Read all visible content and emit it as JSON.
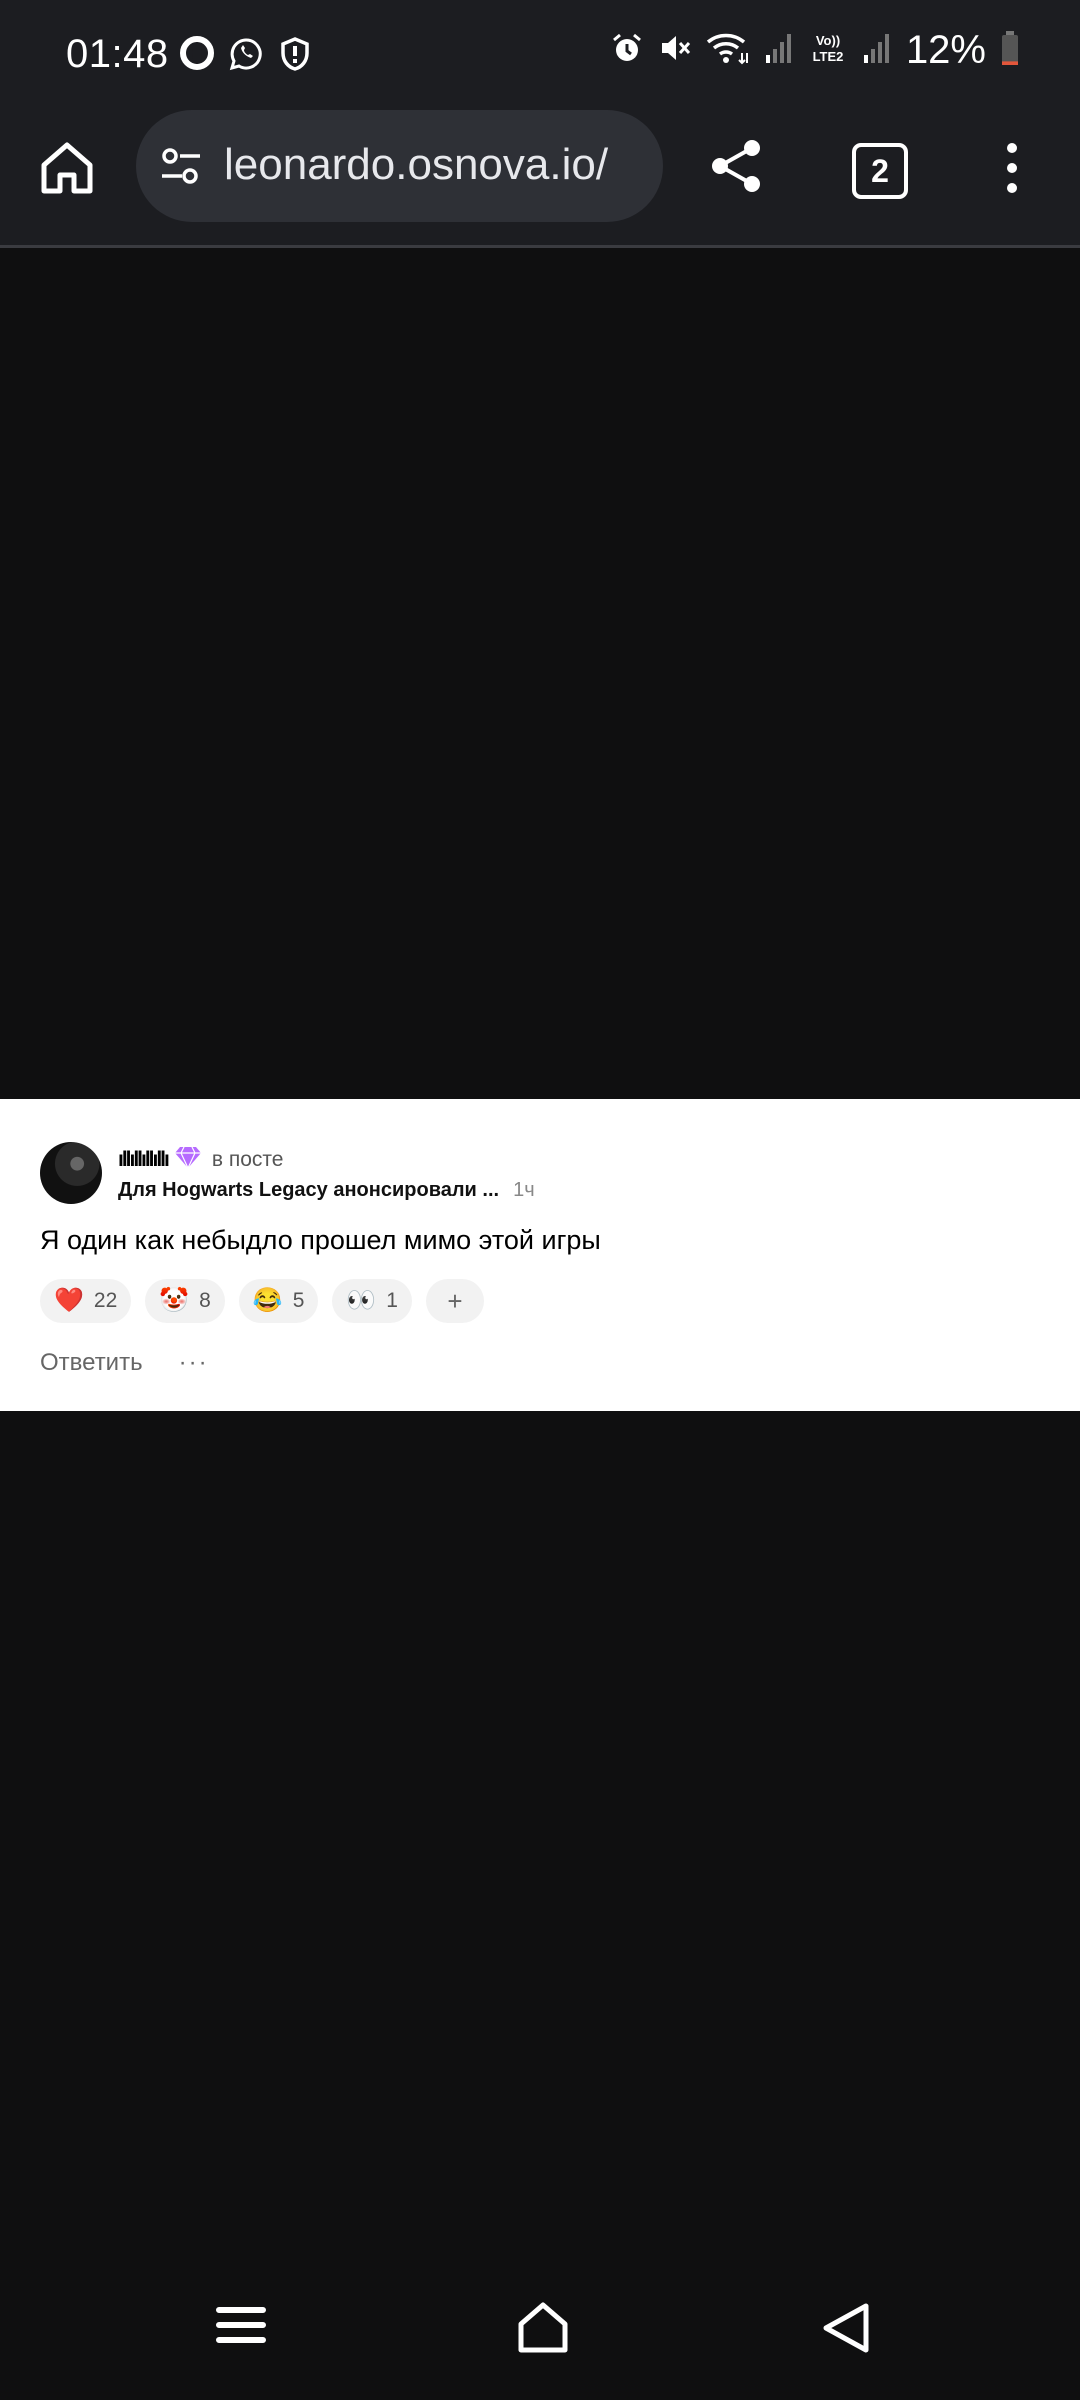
{
  "status_bar": {
    "time": "01:48",
    "left_icons": [
      "opera-icon",
      "whatsapp-icon",
      "shield-icon"
    ],
    "right_icons": [
      "alarm-icon",
      "mute-icon",
      "wifi-icon",
      "signal-icon",
      "volte-icon",
      "signal-icon"
    ],
    "volte_label": "Vo)\nLTE2",
    "battery_percent": "12%",
    "battery_level": 0.12
  },
  "browser": {
    "url": "leonardo.osnova.io/",
    "tab_count": "2",
    "icons": {
      "home": "home-icon",
      "site_settings": "tune-icon",
      "share": "share-icon",
      "menu": "more-vert-icon"
    }
  },
  "comment": {
    "author": "ıllıllıllıllı",
    "badge": "gem-icon",
    "in_post_label": "в посте",
    "post_title": "Для Hogwarts Legacy анонсировали ...",
    "time": "1ч",
    "text": "Я один как небыдло прошел мимо этой игры",
    "reactions": [
      {
        "emoji": "❤️",
        "count": "22",
        "name": "heart"
      },
      {
        "emoji": "🤡",
        "count": "8",
        "name": "clown"
      },
      {
        "emoji": "😂",
        "count": "5",
        "name": "laugh"
      },
      {
        "emoji": "👀",
        "count": "1",
        "name": "eyes"
      }
    ],
    "add_reaction": "+",
    "reply_label": "Ответить",
    "more_label": "···"
  },
  "navbar": {
    "icons": [
      "recents-icon",
      "home-icon",
      "back-icon"
    ]
  },
  "colors": {
    "page_bg": "#0f0f10",
    "toolbar_bg": "#1c1d21",
    "urlbar_bg": "#2e3036",
    "gem": "#b66bff"
  }
}
